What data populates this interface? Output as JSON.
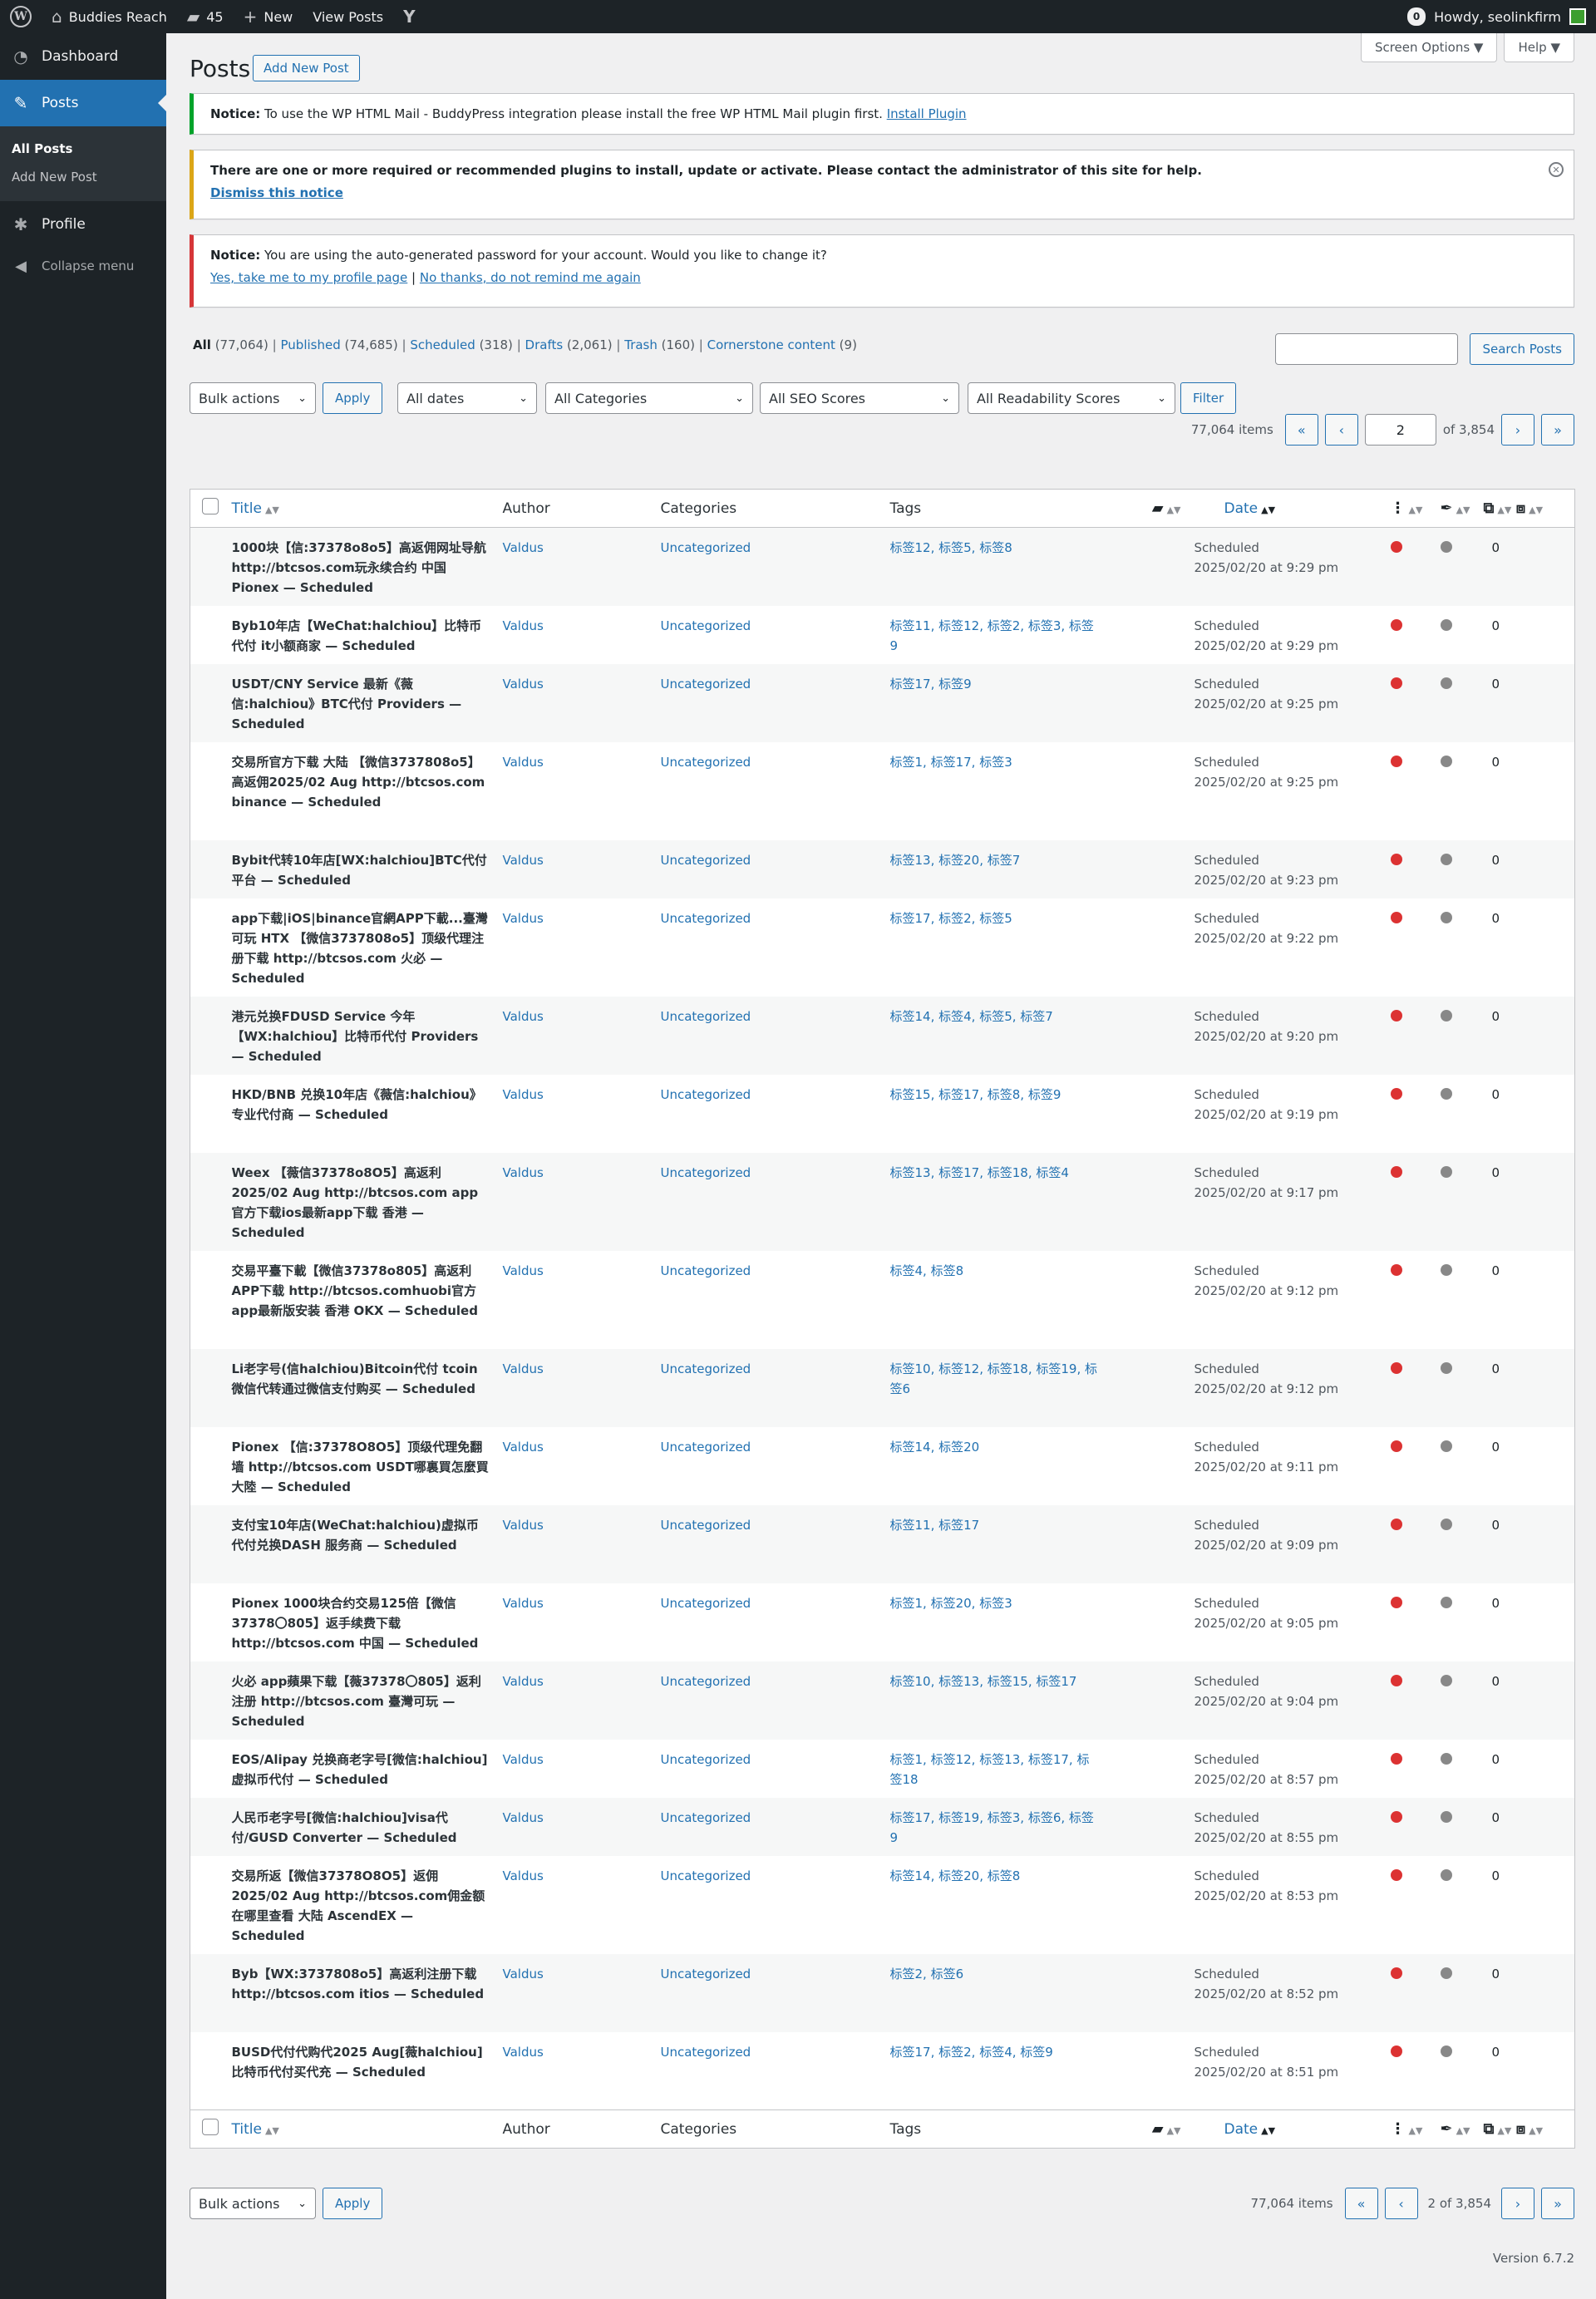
{
  "adminbar": {
    "site_name": "Buddies Reach",
    "comments_count": "45",
    "new_label": "New",
    "view_posts": "View Posts",
    "notifications": "0",
    "howdy": "Howdy, seolinkfirm"
  },
  "sidebar": {
    "dashboard": "Dashboard",
    "posts": "Posts",
    "all_posts": "All Posts",
    "add_new_post": "Add New Post",
    "profile": "Profile",
    "collapse": "Collapse menu"
  },
  "header": {
    "screen_options": "Screen Options ▼",
    "help": "Help ▼",
    "title": "Posts",
    "add_new": "Add New Post"
  },
  "notices": {
    "n1_label": "Notice:",
    "n1_text": " To use the WP HTML Mail - BuddyPress integration please install the free WP HTML Mail plugin first. ",
    "n1_link": "Install Plugin",
    "n2_text": "There are one or more required or recommended plugins to install, update or activate. Please contact the administrator of this site for help.",
    "n2_link": "Dismiss this notice",
    "n3_label": "Notice:",
    "n3_text": " You are using the auto-generated password for your account. Would you like to change it?",
    "n3_link1": "Yes, take me to my profile page",
    "n3_sep": " | ",
    "n3_link2": "No thanks, do not remind me again"
  },
  "views": {
    "all": "All",
    "all_count": "(77,064)",
    "published": "Published",
    "published_count": "(74,685)",
    "scheduled": "Scheduled",
    "scheduled_count": "(318)",
    "drafts": "Drafts",
    "drafts_count": "(2,061)",
    "trash": "Trash",
    "trash_count": "(160)",
    "cornerstone": "Cornerstone content",
    "cornerstone_count": "(9)",
    "sep": "|"
  },
  "search": {
    "button": "Search Posts"
  },
  "filters": {
    "bulk": "Bulk actions",
    "apply": "Apply",
    "dates": "All dates",
    "categories": "All Categories",
    "seo": "All SEO Scores",
    "readability": "All Readability Scores",
    "filter": "Filter"
  },
  "pagination": {
    "items": "77,064 items",
    "first": "«",
    "prev": "‹",
    "next": "›",
    "last": "»",
    "current_page": "2",
    "of_total": "of 3,854",
    "bottom_label": "2 of 3,854"
  },
  "columns": {
    "title": "Title",
    "author": "Author",
    "categories": "Categories",
    "tags": "Tags",
    "date": "Date"
  },
  "status_colors": {
    "seo": "#dc3232",
    "readability": "#888888"
  },
  "rows": [
    {
      "title": "1000块【信:37378o8o5】高返佣网址导航 http://btcsos.com玩永续合约 中国 Pionex — Scheduled",
      "author": "Valdus",
      "category": "Uncategorized",
      "tags": "标签12, 标签5, 标签8",
      "status": "Scheduled",
      "date": "2025/02/20 at 9:29 pm",
      "links": "0"
    },
    {
      "title": "Byb10年店【WeChat:halchiou】比特币代付 it小额商家 — Scheduled",
      "author": "Valdus",
      "category": "Uncategorized",
      "tags": "标签11, 标签12, 标签2, 标签3, 标签9",
      "status": "Scheduled",
      "date": "2025/02/20 at 9:29 pm",
      "links": "0"
    },
    {
      "title": "USDT/CNY Service 最新《薇信:halchiou》BTC代付 Providers — Scheduled",
      "author": "Valdus",
      "category": "Uncategorized",
      "tags": "标签17, 标签9",
      "status": "Scheduled",
      "date": "2025/02/20 at 9:25 pm",
      "links": "0"
    },
    {
      "title": "交易所官方下载 大陆 【微信3737808o5】高返佣2025/02 Aug http://btcsos.com binance — Scheduled",
      "author": "Valdus",
      "category": "Uncategorized",
      "tags": "标签1, 标签17, 标签3",
      "status": "Scheduled",
      "date": "2025/02/20 at 9:25 pm",
      "links": "0"
    },
    {
      "title": "Bybit代转10年店[WX:halchiou]BTC代付平台 — Scheduled",
      "author": "Valdus",
      "category": "Uncategorized",
      "tags": "标签13, 标签20, 标签7",
      "status": "Scheduled",
      "date": "2025/02/20 at 9:23 pm",
      "links": "0"
    },
    {
      "title": "app下载|iOS|binance官網APP下載...臺灣可玩 HTX 【微信3737808o5】顶级代理注册下载 http://btcsos.com 火必 — Scheduled",
      "author": "Valdus",
      "category": "Uncategorized",
      "tags": "标签17, 标签2, 标签5",
      "status": "Scheduled",
      "date": "2025/02/20 at 9:22 pm",
      "links": "0"
    },
    {
      "title": "港元兑换FDUSD Service 今年【WX:halchiou】比特币代付 Providers — Scheduled",
      "author": "Valdus",
      "category": "Uncategorized",
      "tags": "标签14, 标签4, 标签5, 标签7",
      "status": "Scheduled",
      "date": "2025/02/20 at 9:20 pm",
      "links": "0"
    },
    {
      "title": "HKD/BNB 兑换10年店《薇信:halchiou》专业代付商 — Scheduled",
      "author": "Valdus",
      "category": "Uncategorized",
      "tags": "标签15, 标签17, 标签8, 标签9",
      "status": "Scheduled",
      "date": "2025/02/20 at 9:19 pm",
      "links": "0"
    },
    {
      "title": "Weex 【薇信37378o8O5】高返利 2025/02 Aug http://btcsos.com app官方下载ios最新app下载 香港 — Scheduled",
      "author": "Valdus",
      "category": "Uncategorized",
      "tags": "标签13, 标签17, 标签18, 标签4",
      "status": "Scheduled",
      "date": "2025/02/20 at 9:17 pm",
      "links": "0"
    },
    {
      "title": "交易平臺下載【微信37378o805】高返利APP下载 http://btcsos.comhuobi官方app最新版安装 香港 OKX — Scheduled",
      "author": "Valdus",
      "category": "Uncategorized",
      "tags": "标签4, 标签8",
      "status": "Scheduled",
      "date": "2025/02/20 at 9:12 pm",
      "links": "0"
    },
    {
      "title": "Li老字号(信halchiou)Bitcoin代付 tcoin微信代转通过微信支付购买 — Scheduled",
      "author": "Valdus",
      "category": "Uncategorized",
      "tags": "标签10, 标签12, 标签18, 标签19, 标签6",
      "status": "Scheduled",
      "date": "2025/02/20 at 9:12 pm",
      "links": "0"
    },
    {
      "title": "Pionex 【信:37378O8O5】顶级代理免翻墙 http://btcsos.com USDT哪裏買怎麼買 大陸 — Scheduled",
      "author": "Valdus",
      "category": "Uncategorized",
      "tags": "标签14, 标签20",
      "status": "Scheduled",
      "date": "2025/02/20 at 9:11 pm",
      "links": "0"
    },
    {
      "title": "支付宝10年店(WeChat:halchiou)虚拟币代付兑换DASH 服务商 — Scheduled",
      "author": "Valdus",
      "category": "Uncategorized",
      "tags": "标签11, 标签17",
      "status": "Scheduled",
      "date": "2025/02/20 at 9:09 pm",
      "links": "0"
    },
    {
      "title": "Pionex 1000块合约交易125倍【微信37378〇805】返手续费下载 http://btcsos.com 中国 — Scheduled",
      "author": "Valdus",
      "category": "Uncategorized",
      "tags": "标签1, 标签20, 标签3",
      "status": "Scheduled",
      "date": "2025/02/20 at 9:05 pm",
      "links": "0"
    },
    {
      "title": "火必 app蘋果下载【薇37378〇805】返利注册 http://btcsos.com 臺灣可玩 — Scheduled",
      "author": "Valdus",
      "category": "Uncategorized",
      "tags": "标签10, 标签13, 标签15, 标签17",
      "status": "Scheduled",
      "date": "2025/02/20 at 9:04 pm",
      "links": "0"
    },
    {
      "title": "EOS/Alipay 兑换商老字号[微信:halchiou]虚拟币代付 — Scheduled",
      "author": "Valdus",
      "category": "Uncategorized",
      "tags": "标签1, 标签12, 标签13, 标签17, 标签18",
      "status": "Scheduled",
      "date": "2025/02/20 at 8:57 pm",
      "links": "0"
    },
    {
      "title": "人民币老字号[微信:halchiou]visa代付/GUSD Converter — Scheduled",
      "author": "Valdus",
      "category": "Uncategorized",
      "tags": "标签17, 标签19, 标签3, 标签6, 标签9",
      "status": "Scheduled",
      "date": "2025/02/20 at 8:55 pm",
      "links": "0"
    },
    {
      "title": "交易所返【微信37378O8O5】返佣2025/02 Aug http://btcsos.com佣金额在哪里查看 大陆 AscendEX — Scheduled",
      "author": "Valdus",
      "category": "Uncategorized",
      "tags": "标签14, 标签20, 标签8",
      "status": "Scheduled",
      "date": "2025/02/20 at 8:53 pm",
      "links": "0"
    },
    {
      "title": "Byb【WX:3737808o5】高返利注册下载 http://btcsos.com itios — Scheduled",
      "author": "Valdus",
      "category": "Uncategorized",
      "tags": "标签2, 标签6",
      "status": "Scheduled",
      "date": "2025/02/20 at 8:52 pm",
      "links": "0"
    },
    {
      "title": "BUSD代付代购代2025 Aug[薇halchiou]比特币代付买代充 — Scheduled",
      "author": "Valdus",
      "category": "Uncategorized",
      "tags": "标签17, 标签2, 标签4, 标签9",
      "status": "Scheduled",
      "date": "2025/02/20 at 8:51 pm",
      "links": "0"
    }
  ],
  "footer": {
    "version": "Version 6.7.2"
  }
}
